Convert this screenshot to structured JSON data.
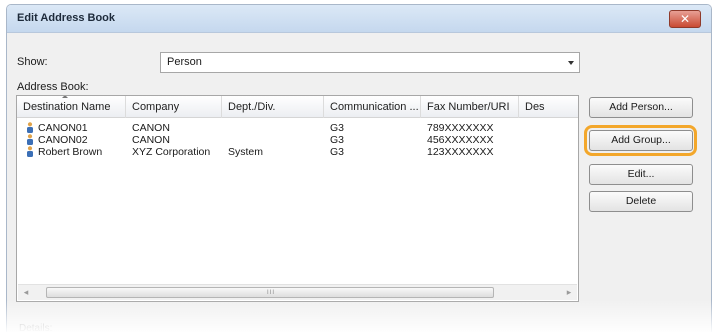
{
  "window": {
    "title": "Edit Address Book",
    "close_glyph": "✕"
  },
  "show": {
    "label": "Show:",
    "value": "Person"
  },
  "address_book": {
    "label": "Address Book:"
  },
  "columns": [
    "Destination Name",
    "Company",
    "Dept./Div.",
    "Communication ...",
    "Fax Number/URI",
    "Des"
  ],
  "rows": [
    {
      "name": "CANON01",
      "company": "CANON",
      "dept": "",
      "comm": "G3",
      "fax": "789XXXXXXX"
    },
    {
      "name": "CANON02",
      "company": "CANON",
      "dept": "",
      "comm": "G3",
      "fax": "456XXXXXXX"
    },
    {
      "name": "Robert Brown",
      "company": "XYZ Corporation",
      "dept": "System",
      "comm": "G3",
      "fax": "123XXXXXXX"
    }
  ],
  "scroll": {
    "left": "◂",
    "right": "▸",
    "grip": "III"
  },
  "buttons": {
    "add_person": "Add Person...",
    "add_group": "Add Group...",
    "edit": "Edit...",
    "delete": "Delete"
  },
  "details": {
    "label": "Details:"
  },
  "colors": {
    "highlight": "#f3a72b",
    "title_bar": "#c5d8ee"
  }
}
